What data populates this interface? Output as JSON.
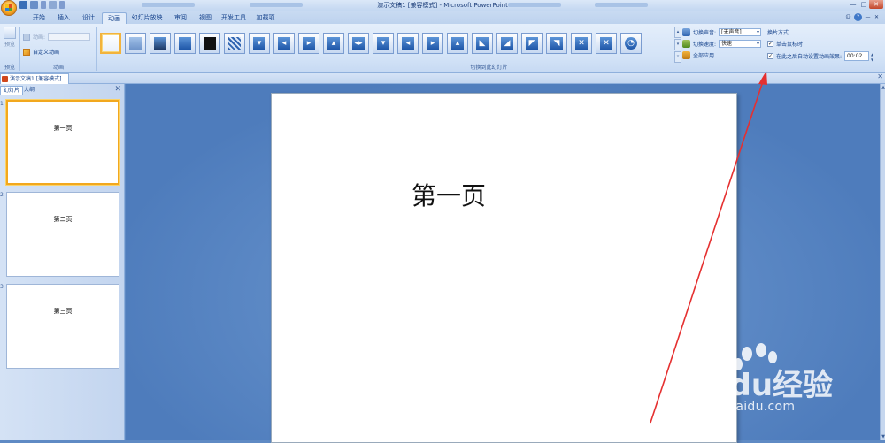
{
  "window": {
    "title": "演示文稿1 [兼容模式] - Microsoft PowerPoint",
    "controls": [
      "—",
      "□",
      "✕"
    ]
  },
  "ribbon_tabs": [
    "开始",
    "插入",
    "设计",
    "动画",
    "幻灯片放映",
    "审阅",
    "视图",
    "开发工具",
    "加载项"
  ],
  "active_tab": "动画",
  "help_icons": [
    "☺",
    "?",
    "—",
    "✕"
  ],
  "groups": {
    "preview": {
      "button_label": "预览",
      "label": "预览"
    },
    "animation": {
      "animate_label": "动画:",
      "custom_label": "自定义动画",
      "label": "动画"
    },
    "transition_gallery": {
      "label": "切换到此幻灯片"
    }
  },
  "transition_options": {
    "sound_label": "切换声音:",
    "sound_value": "[无声音]",
    "speed_label": "切换速度:",
    "speed_value": "快速",
    "apply_all_label": "全部应用"
  },
  "advance_slide": {
    "heading": "换片方式",
    "on_click_label": "单击鼠标时",
    "on_click_checked": "✓",
    "auto_label": "在此之后自动设置动画效果:",
    "auto_checked": "✓",
    "auto_time": "00:02"
  },
  "gallery_scroll": [
    "▴",
    "▾",
    "▿"
  ],
  "doc_tab": {
    "label": "演示文稿1 [兼容模式]",
    "close": "✕"
  },
  "panel": {
    "tab_slides": "幻灯片",
    "tab_outline": "大纲",
    "close": "✕",
    "slides": [
      {
        "number": "1",
        "title": "第一页"
      },
      {
        "number": "2",
        "title": "第二页"
      },
      {
        "number": "3",
        "title": "第三页"
      }
    ]
  },
  "current_slide": {
    "title": "第一页"
  },
  "scrollbar": {
    "up": "▲",
    "down": "▼"
  },
  "watermark": {
    "brand": "Baidu经验",
    "url": "jingyan.baidu.com"
  },
  "annotation": {
    "color": "#e53030"
  }
}
